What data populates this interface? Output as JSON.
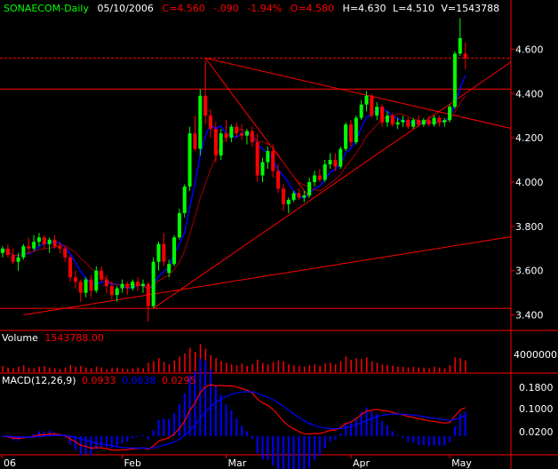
{
  "header": {
    "title": "SONAECOM-Daily",
    "date": "05/10/2006",
    "close": "C=4.560",
    "change": "-.090",
    "change_pct": "-1.94%",
    "open": "O=4.580",
    "high": "H=4.630",
    "low": "L=4.510",
    "volume": "V=1543788"
  },
  "volume_panel": {
    "label": "Volume",
    "value": "1543788.00",
    "tick": "4000000"
  },
  "macd_panel": {
    "label": "MACD(12,26,9)",
    "v1": "0.0933",
    "v2": "0.0638",
    "v3": "0.0295",
    "ticks": [
      "0.1800",
      "0.1000",
      "0.0200"
    ]
  },
  "colors": {
    "up": "#00ff00",
    "down": "#ff0000",
    "trend": "#ff0000",
    "ma": "#0000ff",
    "grid": "#ff0000",
    "text": "#ffffff",
    "bg": "#000000",
    "volume": "#ff0000",
    "macd_hist": "#0000ff",
    "signal": "#ff0000"
  },
  "chart_data": {
    "type": "candlestick",
    "title": "SONAECOM-Daily",
    "y_ticks": [
      "4.600",
      "4.400",
      "4.200",
      "4.000",
      "3.800",
      "3.600",
      "3.400"
    ],
    "ylim": [
      3.33,
      4.75
    ],
    "x_ticks": [
      "06",
      "Feb",
      "Mar",
      "Apr",
      "May"
    ],
    "horizontal_lines": [
      4.42,
      3.43
    ],
    "resistance_dashed": 4.56,
    "candles": [
      [
        3.68,
        3.71,
        3.66,
        3.7
      ],
      [
        3.7,
        3.72,
        3.66,
        3.67
      ],
      [
        3.67,
        3.7,
        3.63,
        3.64
      ],
      [
        3.64,
        3.68,
        3.6,
        3.66
      ],
      [
        3.66,
        3.72,
        3.65,
        3.71
      ],
      [
        3.71,
        3.75,
        3.68,
        3.7
      ],
      [
        3.7,
        3.76,
        3.69,
        3.73
      ],
      [
        3.73,
        3.77,
        3.71,
        3.75
      ],
      [
        3.75,
        3.76,
        3.7,
        3.72
      ],
      [
        3.72,
        3.75,
        3.68,
        3.74
      ],
      [
        3.74,
        3.76,
        3.7,
        3.71
      ],
      [
        3.71,
        3.73,
        3.68,
        3.7
      ],
      [
        3.7,
        3.71,
        3.64,
        3.66
      ],
      [
        3.66,
        3.67,
        3.55,
        3.57
      ],
      [
        3.57,
        3.6,
        3.52,
        3.55
      ],
      [
        3.55,
        3.56,
        3.46,
        3.5
      ],
      [
        3.5,
        3.57,
        3.48,
        3.56
      ],
      [
        3.56,
        3.58,
        3.48,
        3.51
      ],
      [
        3.51,
        3.62,
        3.5,
        3.6
      ],
      [
        3.6,
        3.62,
        3.55,
        3.56
      ],
      [
        3.56,
        3.58,
        3.5,
        3.53
      ],
      [
        3.53,
        3.55,
        3.47,
        3.49
      ],
      [
        3.49,
        3.53,
        3.46,
        3.52
      ],
      [
        3.52,
        3.56,
        3.5,
        3.54
      ],
      [
        3.54,
        3.55,
        3.49,
        3.52
      ],
      [
        3.52,
        3.56,
        3.51,
        3.55
      ],
      [
        3.55,
        3.57,
        3.51,
        3.53
      ],
      [
        3.53,
        3.56,
        3.5,
        3.54
      ],
      [
        3.54,
        3.55,
        3.37,
        3.44
      ],
      [
        3.44,
        3.66,
        3.43,
        3.64
      ],
      [
        3.64,
        3.73,
        3.6,
        3.72
      ],
      [
        3.72,
        3.77,
        3.62,
        3.64
      ],
      [
        3.59,
        3.65,
        3.57,
        3.63
      ],
      [
        3.63,
        3.76,
        3.62,
        3.75
      ],
      [
        3.75,
        3.88,
        3.74,
        3.86
      ],
      [
        3.86,
        3.99,
        3.84,
        3.98
      ],
      [
        3.98,
        4.25,
        3.96,
        4.22
      ],
      [
        4.22,
        4.3,
        4.14,
        4.15
      ],
      [
        4.15,
        4.42,
        4.12,
        4.39
      ],
      [
        4.39,
        4.55,
        4.26,
        4.3
      ],
      [
        4.3,
        4.33,
        4.2,
        4.24
      ],
      [
        4.24,
        4.27,
        4.09,
        4.12
      ],
      [
        4.12,
        4.24,
        4.1,
        4.22
      ],
      [
        4.22,
        4.28,
        4.18,
        4.2
      ],
      [
        4.2,
        4.26,
        4.18,
        4.25
      ],
      [
        4.25,
        4.27,
        4.2,
        4.22
      ],
      [
        4.22,
        4.26,
        4.19,
        4.21
      ],
      [
        4.21,
        4.24,
        4.17,
        4.23
      ],
      [
        4.23,
        4.25,
        4.16,
        4.18
      ],
      [
        4.18,
        4.22,
        4.0,
        4.03
      ],
      [
        4.03,
        4.11,
        4.0,
        4.09
      ],
      [
        4.09,
        4.16,
        4.06,
        4.14
      ],
      [
        4.14,
        4.17,
        4.02,
        4.05
      ],
      [
        4.05,
        4.08,
        3.95,
        3.97
      ],
      [
        3.97,
        3.99,
        3.87,
        3.9
      ],
      [
        3.9,
        3.93,
        3.86,
        3.92
      ],
      [
        3.92,
        3.96,
        3.91,
        3.95
      ],
      [
        3.95,
        3.97,
        3.92,
        3.93
      ],
      [
        3.93,
        3.96,
        3.91,
        3.94
      ],
      [
        3.94,
        4.02,
        3.93,
        4.0
      ],
      [
        4.0,
        4.05,
        3.98,
        4.03
      ],
      [
        4.03,
        4.06,
        4.0,
        4.01
      ],
      [
        4.01,
        4.1,
        4.0,
        4.08
      ],
      [
        4.08,
        4.13,
        4.06,
        4.1
      ],
      [
        4.1,
        4.13,
        4.05,
        4.07
      ],
      [
        4.07,
        4.16,
        4.06,
        4.15
      ],
      [
        4.15,
        4.27,
        4.14,
        4.26
      ],
      [
        4.26,
        4.28,
        4.16,
        4.18
      ],
      [
        4.18,
        4.3,
        4.17,
        4.29
      ],
      [
        4.29,
        4.37,
        4.28,
        4.35
      ],
      [
        4.35,
        4.41,
        4.32,
        4.39
      ],
      [
        4.39,
        4.4,
        4.29,
        4.3
      ],
      [
        4.3,
        4.36,
        4.28,
        4.34
      ],
      [
        4.34,
        4.35,
        4.25,
        4.27
      ],
      [
        4.27,
        4.32,
        4.25,
        4.3
      ],
      [
        4.3,
        4.31,
        4.25,
        4.26
      ],
      [
        4.26,
        4.29,
        4.24,
        4.27
      ],
      [
        4.27,
        4.3,
        4.25,
        4.28
      ],
      [
        4.28,
        4.29,
        4.24,
        4.25
      ],
      [
        4.25,
        4.29,
        4.24,
        4.28
      ],
      [
        4.28,
        4.3,
        4.25,
        4.26
      ],
      [
        4.26,
        4.29,
        4.25,
        4.28
      ],
      [
        4.28,
        4.3,
        4.25,
        4.26
      ],
      [
        4.26,
        4.3,
        4.25,
        4.29
      ],
      [
        4.29,
        4.3,
        4.25,
        4.27
      ],
      [
        4.27,
        4.29,
        4.25,
        4.28
      ],
      [
        4.28,
        4.35,
        4.27,
        4.34
      ],
      [
        4.34,
        4.59,
        4.33,
        4.58
      ],
      [
        4.58,
        4.74,
        4.57,
        4.65
      ],
      [
        4.58,
        4.63,
        4.51,
        4.56
      ]
    ],
    "volume": [
      0.8,
      0.6,
      0.5,
      0.7,
      0.9,
      0.6,
      0.5,
      0.7,
      0.8,
      0.6,
      0.5,
      0.4,
      0.6,
      0.9,
      0.7,
      0.8,
      0.6,
      0.5,
      0.7,
      0.6,
      0.4,
      0.5,
      0.6,
      0.5,
      0.4,
      0.5,
      0.6,
      0.5,
      1.2,
      1.4,
      1.8,
      1.3,
      1.0,
      1.5,
      2.0,
      2.4,
      3.1,
      2.6,
      3.6,
      3.0,
      2.2,
      1.8,
      1.4,
      1.2,
      1.0,
      0.9,
      1.1,
      0.8,
      1.0,
      1.6,
      1.2,
      1.0,
      1.3,
      1.5,
      1.4,
      1.0,
      0.9,
      0.8,
      0.7,
      0.9,
      1.0,
      0.8,
      1.1,
      1.2,
      1.0,
      1.4,
      2.0,
      1.6,
      1.8,
      1.7,
      1.9,
      1.4,
      1.2,
      1.0,
      0.9,
      0.8,
      0.7,
      0.7,
      0.6,
      0.7,
      0.6,
      0.6,
      0.5,
      0.7,
      0.6,
      0.5,
      0.9,
      1.9,
      1.8,
      1.5
    ],
    "trendlines": [
      {
        "name": "",
        "points": [
          [
            29,
            3.43
          ],
          [
            89,
            4.4
          ]
        ]
      },
      {
        "name": "",
        "points": [
          [
            4,
            3.4
          ],
          [
            89,
            3.72
          ]
        ]
      },
      {
        "name": "",
        "points": [
          [
            39,
            4.56
          ],
          [
            89,
            4.29
          ]
        ]
      },
      {
        "name": "",
        "points": [
          [
            39,
            4.56
          ],
          [
            59,
            3.93
          ]
        ]
      }
    ]
  }
}
